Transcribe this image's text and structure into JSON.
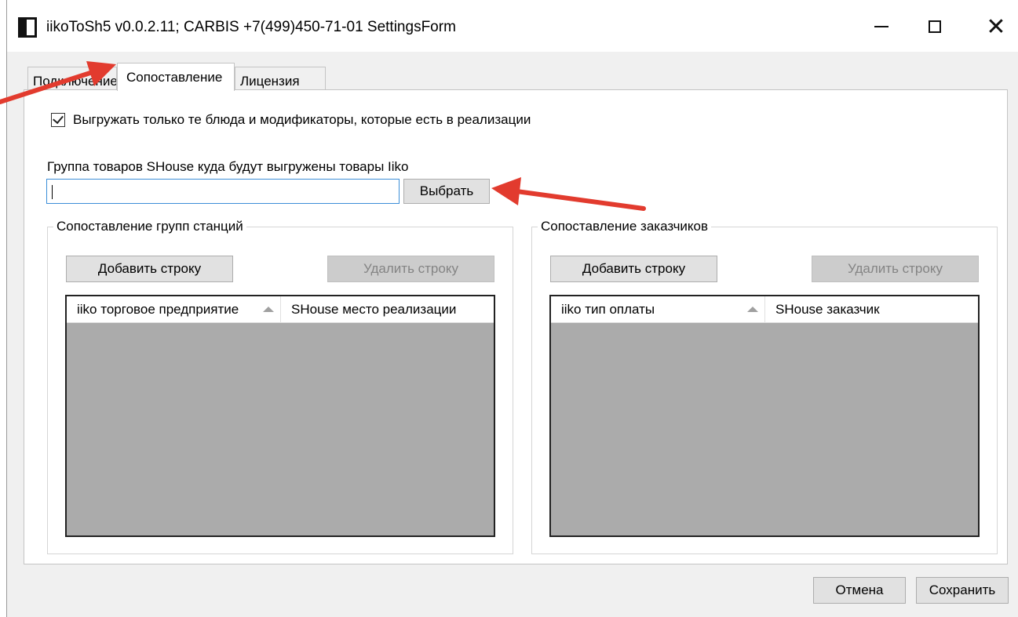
{
  "window": {
    "title": "iikoToSh5 v0.0.2.11;  CARBIS +7(499)450-71-01 SettingsForm",
    "controls": {
      "minimize": "minimize-icon",
      "maximize": "maximize-icon",
      "close": "close-icon"
    }
  },
  "tabs": [
    {
      "label": "Подключение",
      "active": false
    },
    {
      "label": "Сопоставление",
      "active": true
    },
    {
      "label": "Лицензия",
      "active": false
    }
  ],
  "mapping": {
    "checkbox_label": "Выгружать только те блюда и модификаторы, которые есть в реализации",
    "checkbox_checked": true,
    "group_label": "Группа товаров SHouse куда будут выгружены товары Iiko",
    "group_value": "",
    "choose_button": "Выбрать",
    "stations": {
      "legend": "Сопоставление групп станций",
      "add_button": "Добавить строку",
      "delete_button": "Удалить строку",
      "columns": [
        "iiko торговое предприятие",
        "SHouse место реализации"
      ]
    },
    "customers": {
      "legend": "Сопоставление заказчиков",
      "add_button": "Добавить строку",
      "delete_button": "Удалить строку",
      "columns": [
        "iiko тип оплаты",
        "SHouse заказчик"
      ]
    }
  },
  "footer": {
    "cancel_button": "Отмена",
    "save_button": "Сохранить"
  },
  "colors": {
    "annotation_arrow": "#e23b2e",
    "grid_background": "#ababab",
    "input_focus_border": "#3c8ed8"
  }
}
